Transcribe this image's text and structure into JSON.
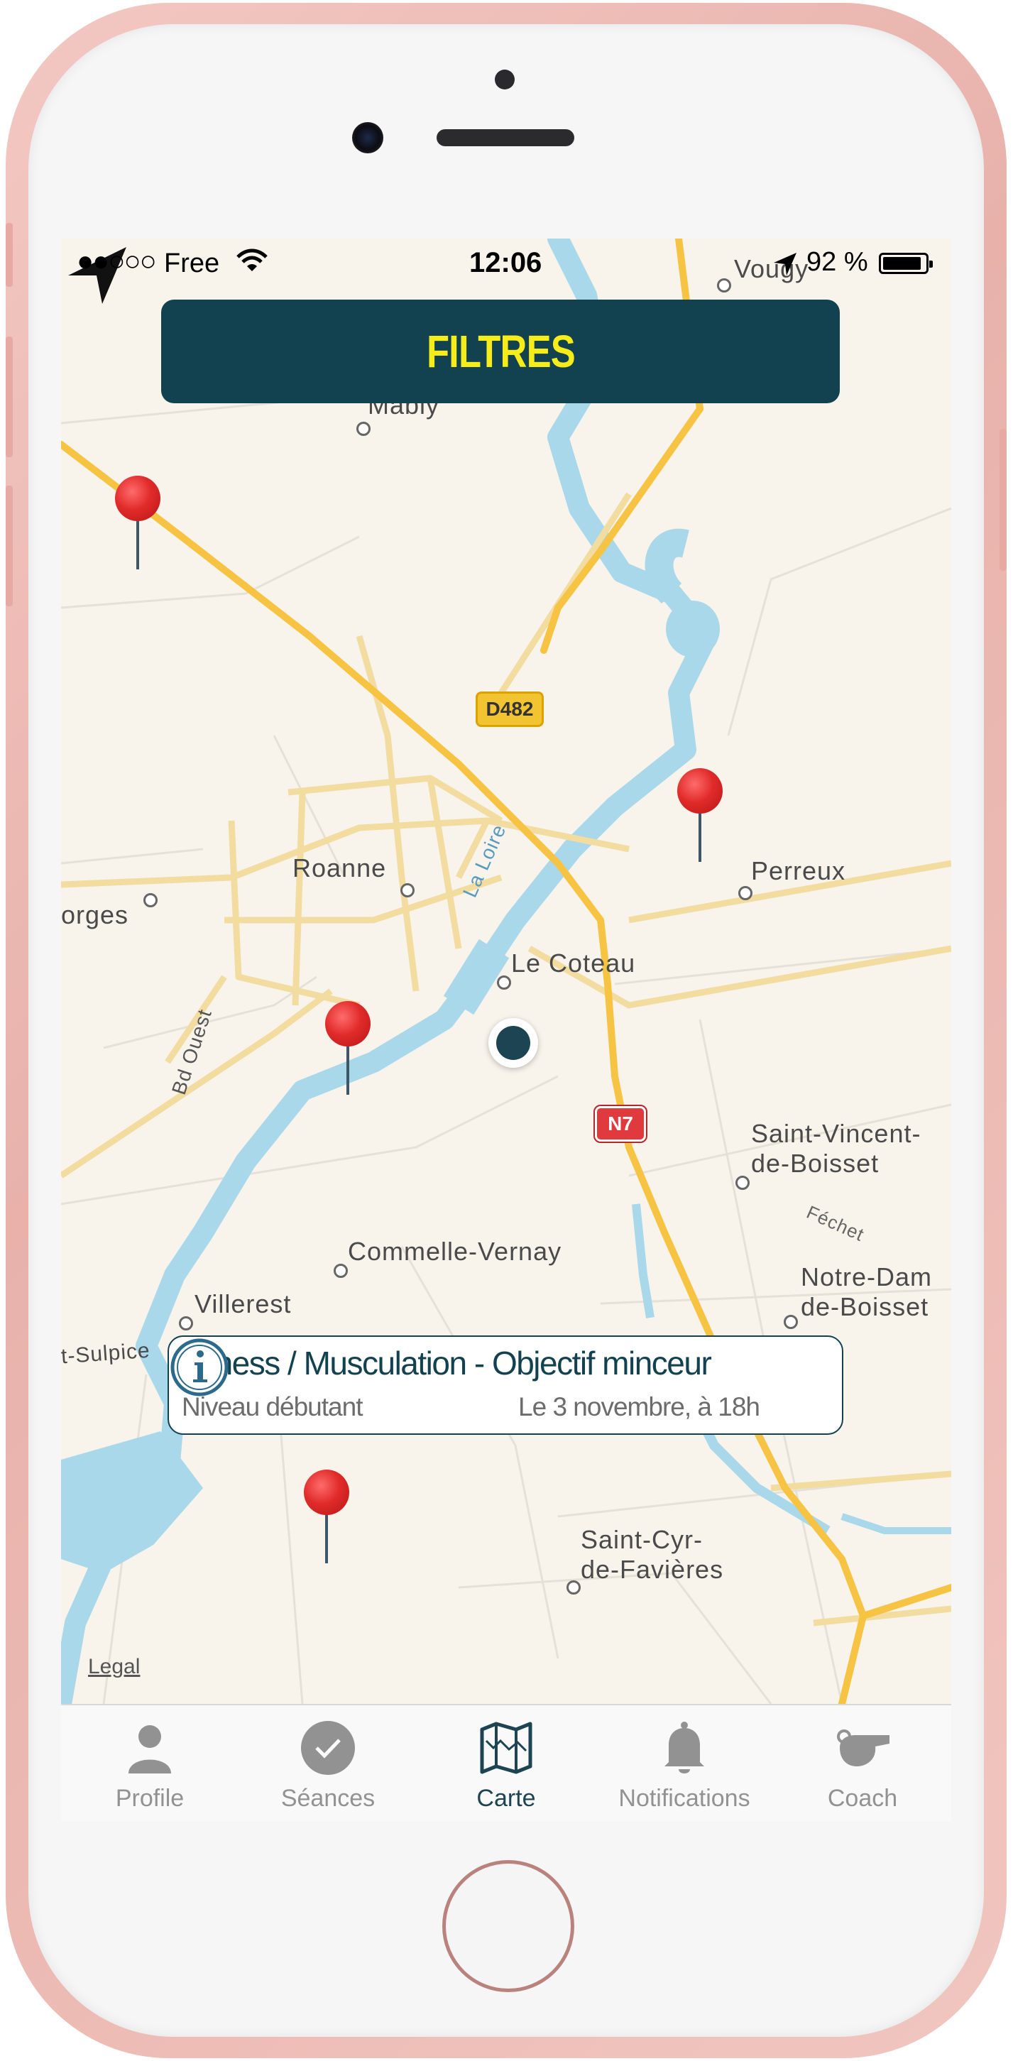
{
  "status_bar": {
    "signal": "●●○○○",
    "carrier": "Free",
    "time": "12:06",
    "battery": "92 %",
    "battery_level": 0.92
  },
  "filter_button": {
    "label": "FILTRES"
  },
  "map": {
    "places": [
      "Mably",
      "Roanne",
      "orges",
      "Le Coteau",
      "Perreux",
      "Saint-Vincent-",
      "de-Boisset",
      "Commelle-Vernay",
      "Villerest",
      "Notre-Dam",
      "de-Boisset",
      "t-Sulpice",
      "Saint-Cyr-",
      "de-Favières",
      "Vougy"
    ],
    "roads": [
      "D482",
      "N7"
    ],
    "streets": [
      "La Loire",
      "Bd Ouest",
      "Féchet"
    ],
    "legal": "Legal",
    "pin_color": "#e12b2b",
    "user_location_color": "#1c4452"
  },
  "callout": {
    "title": "Fitness / Musculation  -  Objectif minceur",
    "level": "Niveau débutant",
    "date": "Le 3 novembre, à 18h",
    "info_icon": "info-icon"
  },
  "tab_bar": {
    "tabs": [
      {
        "label": "Profile",
        "icon": "person-icon",
        "active": false
      },
      {
        "label": "Séances",
        "icon": "checkmark-circle-icon",
        "active": false
      },
      {
        "label": "Carte",
        "icon": "map-icon",
        "active": true
      },
      {
        "label": "Notifications",
        "icon": "bell-icon",
        "active": false
      },
      {
        "label": "Coach",
        "icon": "whistle-icon",
        "active": false
      }
    ],
    "active_color": "#1c4452",
    "inactive_color": "#929292"
  }
}
